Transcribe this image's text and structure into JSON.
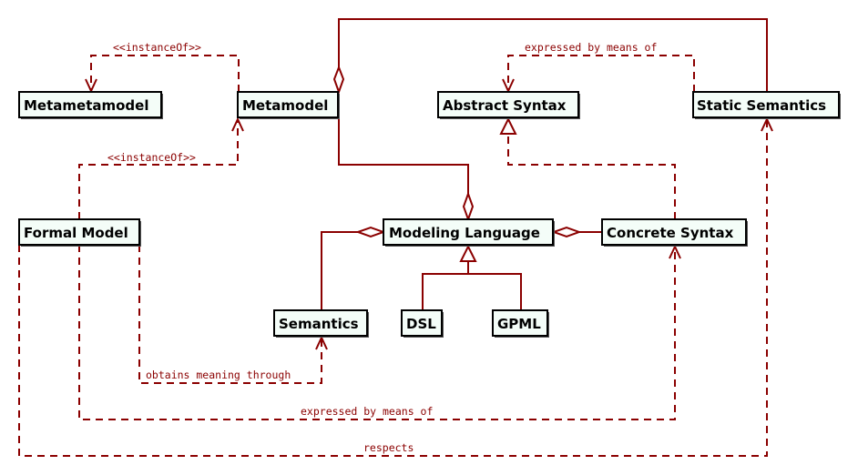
{
  "diagram": {
    "nodes": {
      "metametamodel": "Metametamodel",
      "metamodel": "Metamodel",
      "abstract_syntax": "Abstract Syntax",
      "static_semantics": "Static Semantics",
      "formal_model": "Formal Model",
      "modeling_language": "Modeling Language",
      "concrete_syntax": "Concrete Syntax",
      "semantics": "Semantics",
      "dsl": "DSL",
      "gpml": "GPML"
    },
    "edge_labels": {
      "metamodel_instanceof_metametamodel": "<<instanceOf>>",
      "formal_model_instanceof_metamodel": "<<instanceOf>>",
      "static_semantics_expressed_abstract_syntax": "expressed by means of",
      "formal_model_obtains_meaning_semantics": "obtains meaning through",
      "formal_model_expressed_concrete_syntax": "expressed by means of",
      "formal_model_respects_static_semantics": "respects"
    },
    "colors": {
      "edge": "#8b0000",
      "node_fill": "#f4fdf8",
      "node_border": "#000000"
    }
  }
}
